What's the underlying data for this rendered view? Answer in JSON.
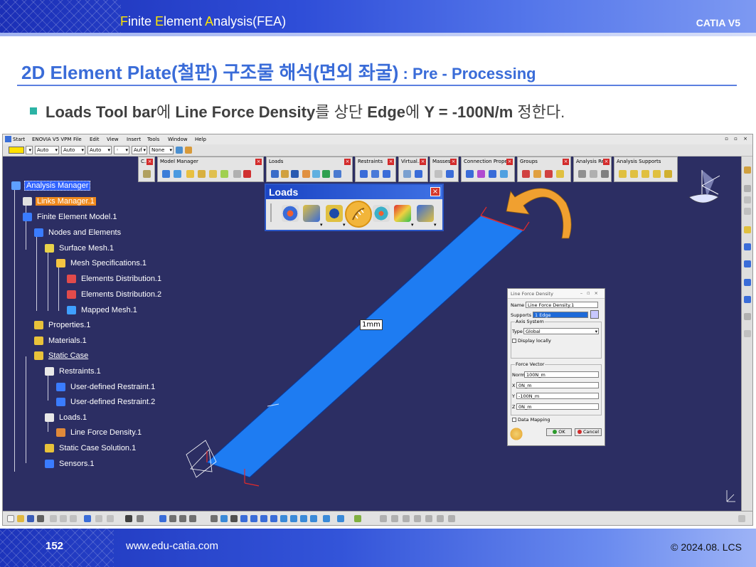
{
  "header": {
    "title_parts": [
      {
        "text": "F",
        "hl": true
      },
      {
        "text": "inite ",
        "hl": false
      },
      {
        "text": "E",
        "hl": true
      },
      {
        "text": "lement ",
        "hl": false
      },
      {
        "text": "A",
        "hl": true
      },
      {
        "text": "nalysis(FEA)",
        "hl": false
      }
    ],
    "right_label": "CATIA V5"
  },
  "page_title": {
    "main": "2D Element Plate(철판) 구조물 해석(면외 좌굴)",
    "sub": " : Pre - Processing"
  },
  "bullet": {
    "p1": "Loads Tool bar",
    "k1": "에 ",
    "p2": "Line Force Density",
    "k2": "를 상단 ",
    "p3": "Edge",
    "k3": "에 ",
    "p4": "Y = -100N/m",
    "k4": " 정한다."
  },
  "app": {
    "menu": [
      "Start",
      "ENOVIA V5 VPM",
      "File",
      "Edit",
      "View",
      "Insert",
      "Tools",
      "Window",
      "Help"
    ],
    "prop_combos": [
      "Auto",
      "Auto",
      "Auto",
      "Auf",
      "None"
    ],
    "toolbars": [
      {
        "title": "C..."
      },
      {
        "title": "Model Manager"
      },
      {
        "title": "Loads"
      },
      {
        "title": "Restraints"
      },
      {
        "title": "Virtual..."
      },
      {
        "title": "Masses"
      },
      {
        "title": "Connection Prope..."
      },
      {
        "title": "Groups"
      },
      {
        "title": "Analysis Re..."
      },
      {
        "title": "Analysis Supports"
      }
    ],
    "tree": [
      {
        "label": "Analysis Manager",
        "style": "sel-blue",
        "icon": "analysis-manager-icon",
        "color": "#5fa0ff"
      },
      {
        "label": "Links Manager.1",
        "style": "sel-orange",
        "icon": "links-manager-icon",
        "color": "#e0e0e0"
      },
      {
        "label": "Finite Element Model.1",
        "style": "",
        "icon": "fem-icon",
        "color": "#3a7cff"
      },
      {
        "label": "Nodes and Elements",
        "style": "",
        "icon": "nodes-icon",
        "color": "#3a7cff"
      },
      {
        "label": "Surface Mesh.1",
        "style": "",
        "icon": "surface-mesh-icon",
        "color": "#e8d24a"
      },
      {
        "label": "Mesh Specifications.1",
        "style": "",
        "icon": "folder-icon",
        "color": "#f5c542"
      },
      {
        "label": "Elements Distribution.1",
        "style": "",
        "icon": "distribution-icon",
        "color": "#e24b4b"
      },
      {
        "label": "Elements Distribution.2",
        "style": "",
        "icon": "distribution-icon",
        "color": "#e24b4b"
      },
      {
        "label": "Mapped Mesh.1",
        "style": "",
        "icon": "mapped-mesh-icon",
        "color": "#3fa0ff"
      },
      {
        "label": "Properties.1",
        "style": "",
        "icon": "properties-icon",
        "color": "#e8c23a"
      },
      {
        "label": "Materials.1",
        "style": "",
        "icon": "materials-icon",
        "color": "#e8c23a"
      },
      {
        "label": "Static Case",
        "style": "u",
        "icon": "static-case-icon",
        "color": "#e8c23a"
      },
      {
        "label": "Restraints.1",
        "style": "",
        "icon": "restraints-icon",
        "color": "#e8e8e8"
      },
      {
        "label": "User-defined Restraint.1",
        "style": "",
        "icon": "restraint-icon",
        "color": "#3a7cff"
      },
      {
        "label": "User-defined Restraint.2",
        "style": "",
        "icon": "restraint-icon",
        "color": "#3a7cff"
      },
      {
        "label": "Loads.1",
        "style": "",
        "icon": "loads-icon",
        "color": "#e8e8e8"
      },
      {
        "label": "Line Force Density.1",
        "style": "",
        "icon": "line-force-icon",
        "color": "#e08a3a"
      },
      {
        "label": "Static Case Solution.1",
        "style": "",
        "icon": "solution-icon",
        "color": "#e8c23a"
      },
      {
        "label": "Sensors.1",
        "style": "",
        "icon": "sensors-icon",
        "color": "#3a7cff"
      }
    ],
    "loads_toolbar": {
      "title": "Loads",
      "icons": [
        "pressure-icon",
        "distributed-force-icon",
        "moment-icon",
        "line-force-density-icon",
        "surface-force-icon",
        "volume-force-icon",
        "force-density-icon"
      ]
    },
    "model_label": "1mm",
    "dialog": {
      "title": "Line Force Density",
      "name_label": "Name",
      "name_value": "Line Force Density.1",
      "supports_label": "Supports",
      "supports_value": "1 Edge",
      "axis_group": "Axis System",
      "type_label": "Type",
      "type_value": "Global",
      "display_locally": "Display locally",
      "force_group": "Force Vector",
      "norm_label": "Norm",
      "norm_value": "100N_m",
      "x_label": "X",
      "x_value": "0N_m",
      "y_label": "Y",
      "y_value": "-100N_m",
      "z_label": "Z",
      "z_value": "0N_m",
      "data_mapping": "Data Mapping",
      "ok": "OK",
      "cancel": "Cancel"
    },
    "colors": {
      "viewport": "#2c2e63",
      "plate": "#1e7cf2",
      "highlight_ring": "#f2b53a",
      "arrow": "#f0a030"
    }
  },
  "footer": {
    "page": "152",
    "site": "www.edu-catia.com",
    "copyright": "© 2024.08. LCS"
  }
}
